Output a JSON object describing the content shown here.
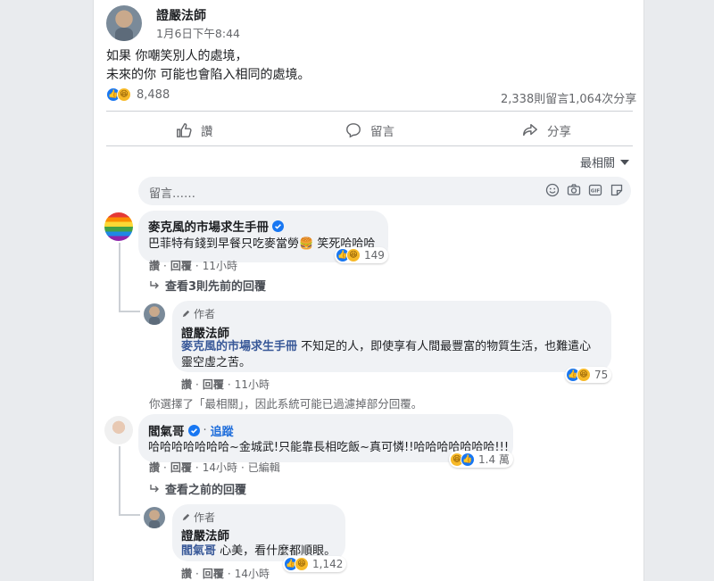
{
  "post": {
    "author": "證嚴法師",
    "time": "1月6日下午8:44",
    "text_line1": "如果 你嘲笑別人的處境，",
    "text_line2": "未來的你 可能也會陷入相同的處境。",
    "reactions_count": "8,488",
    "comments_count": "2,338則留言",
    "shares_count": "1,064次分享"
  },
  "actions": {
    "like": "讚",
    "comment": "留言",
    "share": "分享"
  },
  "sort_label": "最相關",
  "comment_input_placeholder": "留言……",
  "comments": [
    {
      "author": "麥克風的市場求生手冊",
      "text": "巴菲特有錢到早餐只吃麥當勞🍔 笑死哈哈哈",
      "reaction_count": "149",
      "like": "讚",
      "reply": "回覆",
      "time": "11小時",
      "view_prev": "查看3則先前的回覆",
      "reply_item": {
        "badge": "作者",
        "author": "證嚴法師",
        "mention": "麥克風的市場求生手冊",
        "text_a": " 不知足的人，即使享有人間最豐富的物質生活，也難遣心",
        "text_b": "靈空虛之苦。",
        "reaction_count": "75",
        "like": "讚",
        "reply": "回覆",
        "time": "11小時"
      }
    },
    {
      "author": "閻氣哥",
      "follow": "追蹤",
      "text": "哈哈哈哈哈哈哈~金城武!只能靠長相吃飯~真可憐!!哈哈哈哈哈哈哈!!!",
      "reaction_count": "1.4 萬",
      "like": "讚",
      "reply": "回覆",
      "time": "14小時",
      "edited": "已編輯",
      "view_prev": "查看之前的回覆",
      "reply_item": {
        "badge": "作者",
        "author": "證嚴法師",
        "mention": "閻氣哥",
        "text_a": " 心美，看什麼都順眼。",
        "reaction_count": "1,142",
        "like": "讚",
        "reply": "回覆",
        "time": "14小時"
      }
    }
  ],
  "filter_notice": "你選擇了「最相關」，因此系統可能已過濾掉部分回覆。",
  "icons": [
    "verified-icon",
    "like-icon",
    "comment-icon",
    "share-icon",
    "emoji-icon",
    "camera-icon",
    "gif-icon",
    "sticker-icon",
    "reply-arrow-icon",
    "pencil-icon",
    "caret-down-icon"
  ],
  "colors": {
    "facebook_blue": "#1877f2",
    "link_blue": "#216fdb",
    "bubble": "#f0f2f5"
  }
}
